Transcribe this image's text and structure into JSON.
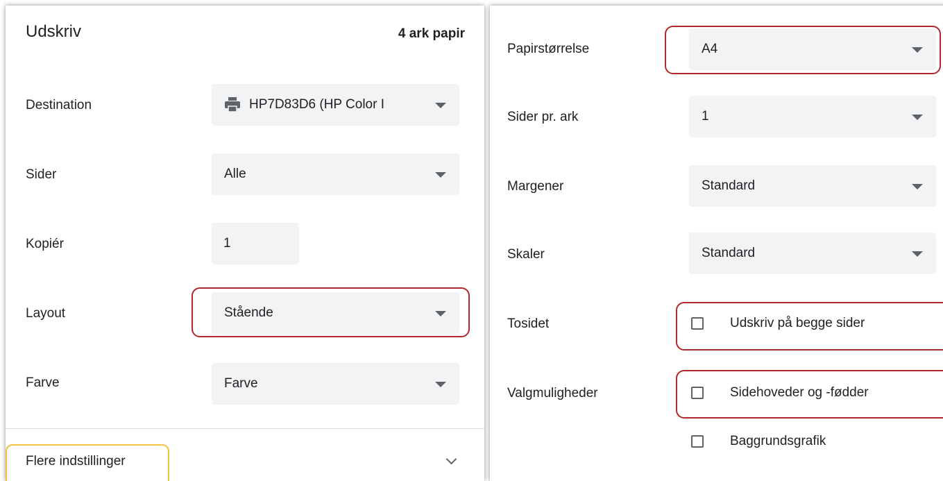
{
  "left": {
    "title": "Udskriv",
    "sheets": "4 ark papir",
    "destination": {
      "label": "Destination",
      "value": "HP7D83D6 (HP Color I"
    },
    "pages": {
      "label": "Sider",
      "value": "Alle"
    },
    "copies": {
      "label": "Kopiér",
      "value": "1"
    },
    "layout": {
      "label": "Layout",
      "value": "Stående"
    },
    "color": {
      "label": "Farve",
      "value": "Farve"
    },
    "more_settings": "Flere indstillinger"
  },
  "right": {
    "paper_size": {
      "label": "Papirstørrelse",
      "value": "A4"
    },
    "pages_per_sheet": {
      "label": "Sider pr. ark",
      "value": "1"
    },
    "margins": {
      "label": "Margener",
      "value": "Standard"
    },
    "scale": {
      "label": "Skaler",
      "value": "Standard"
    },
    "duplex": {
      "label": "Tosidet",
      "option": "Udskriv på begge sider"
    },
    "options": {
      "label": "Valgmuligheder",
      "headers_footers": "Sidehoveder og -fødder",
      "background_graphics": "Baggrundsgrafik"
    }
  },
  "icons": {
    "printer": "printer-icon",
    "expand": "chevron-down-icon"
  },
  "colors": {
    "highlight_red": "#b0272d",
    "highlight_yellow": "#f5c242",
    "field_bg": "#f1f3f4"
  }
}
